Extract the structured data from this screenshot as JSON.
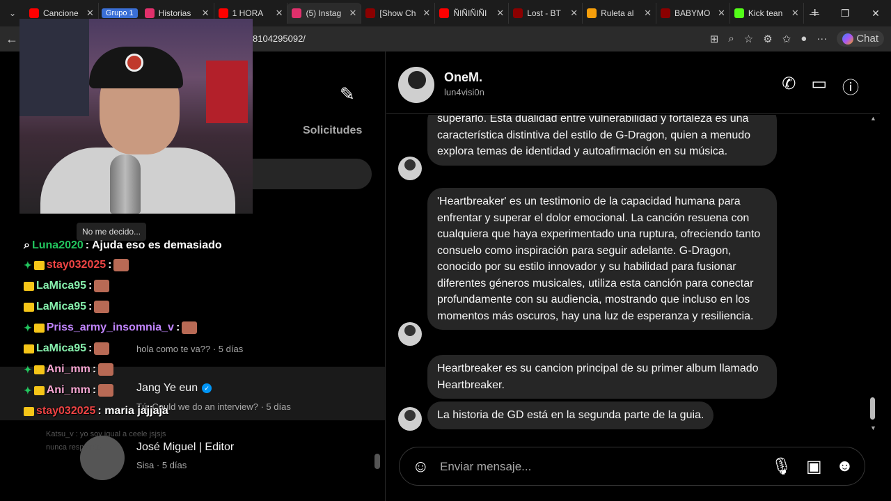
{
  "browser": {
    "tabs": [
      {
        "title": "Cancione",
        "favicon_color": "#ff0000"
      },
      {
        "title": "Historias",
        "favicon_color": "#e1306c"
      },
      {
        "title": "1 HORA",
        "favicon_color": "#ff0000"
      },
      {
        "title": "(5) Instag",
        "favicon_color": "#e1306c",
        "active": true
      },
      {
        "title": "[Show Ch",
        "favicon_color": "#8b0000"
      },
      {
        "title": "ÑIÑIÑIÑI",
        "favicon_color": "#ff0000"
      },
      {
        "title": "Lost - BT",
        "favicon_color": "#8b0000"
      },
      {
        "title": "Ruleta al",
        "favicon_color": "#f59e0b"
      },
      {
        "title": "BABYMO",
        "favicon_color": "#8b0000"
      },
      {
        "title": "Kick tean",
        "favicon_color": "#53fc18"
      }
    ],
    "group_label": "Grupo 1",
    "url": "8104295092/",
    "copilot_label": "Chat"
  },
  "sidebar": {
    "requests_label": "Solicitudes",
    "conversations": [
      {
        "name": "",
        "preview": "hola como te va?? · 5 días"
      },
      {
        "name": "Jang Ye eun",
        "preview": "Tú: Could we do an interview? · 5 días"
      },
      {
        "name": "José Miguel | Editor",
        "preview": "Sisa · 5 días"
      }
    ]
  },
  "overlay": {
    "tooltip": "No me decido...",
    "chat": [
      {
        "user": "Luna2020",
        "msg": ": Ajuda eso es demasiado",
        "color": "#22c55e"
      },
      {
        "user": "stay032025",
        "msg": ":",
        "color": "#ef4444"
      },
      {
        "user": "LaMica95",
        "msg": ":",
        "color": "#86efac"
      },
      {
        "user": "LaMica95",
        "msg": ":",
        "color": "#86efac"
      },
      {
        "user": "Priss_army_insomnia_v",
        "msg": ":",
        "color": "#c084fc"
      },
      {
        "user": "LaMica95",
        "msg": ":",
        "color": "#86efac"
      },
      {
        "user": "Ani_mm",
        "msg": ":",
        "color": "#f9a8d4"
      },
      {
        "user": "Ani_mm",
        "msg": ":",
        "color": "#f9a8d4"
      },
      {
        "user": "stay032025",
        "msg": ": maria jajjaja",
        "color": "#ef4444"
      }
    ],
    "faded_lines": [
      "Katsu_v : yo soy igual a ceele jsjsjs",
      "nunca respondo"
    ]
  },
  "chat": {
    "name": "OneM.",
    "username": "lun4visi0n",
    "messages": [
      "superarlo. Esta dualidad entre vulnerabilidad y fortaleza es una característica distintiva del estilo de G-Dragon, quien a menudo explora temas de identidad y autoafirmación en su música.",
      "'Heartbreaker' es un testimonio de la capacidad humana para enfrentar y superar el dolor emocional. La canción resuena con cualquiera que haya experimentado una ruptura, ofreciendo tanto consuelo como inspiración para seguir adelante. G-Dragon, conocido por su estilo innovador y su habilidad para fusionar diferentes géneros musicales, utiliza esta canción para conectar profundamente con su audiencia, mostrando que incluso en los momentos más oscuros, hay una luz de esperanza y resiliencia.",
      "Heartbreaker es su cancion principal de su primer album llamado Heartbreaker.",
      "La historia de GD está en la segunda parte de la guia."
    ],
    "composer_placeholder": "Enviar mensaje..."
  }
}
